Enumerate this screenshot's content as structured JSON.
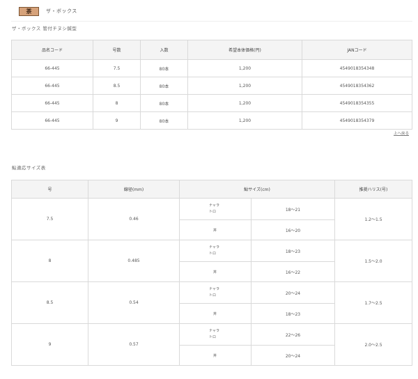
{
  "header": {
    "badge": "茶",
    "title": "ザ・ボックス"
  },
  "section1": {
    "title": "ザ・ボックス 管付チヌシ鍼型",
    "columns": [
      "品名コード",
      "号数",
      "入数",
      "希望本体価格(円)",
      "JANコード"
    ],
    "rows": [
      [
        "66-445",
        "7.5",
        "80本",
        "1,200",
        "4549018354348"
      ],
      [
        "66-445",
        "8.5",
        "80本",
        "1,200",
        "4549018354362"
      ],
      [
        "66-445",
        "8",
        "80本",
        "1,200",
        "4549018354355"
      ],
      [
        "66-445",
        "9",
        "80本",
        "1,200",
        "4549018354379"
      ]
    ],
    "top_link": "上へ戻る"
  },
  "section2": {
    "title": "鮎適応サイズ表",
    "columns": [
      "号",
      "線径(mm)",
      "鮎サイズ(cm)",
      "推奨ハリス(号)"
    ],
    "rows": [
      {
        "gou": "7.5",
        "diameter": "0.46",
        "harisu": "1.2～1.5",
        "types": [
          {
            "label_line1": "ナャラ",
            "label_line2": "トロ",
            "size": "18～21"
          },
          {
            "label": "丼",
            "size": "16～20"
          }
        ]
      },
      {
        "gou": "8",
        "diameter": "0.485",
        "harisu": "1.5～2.0",
        "types": [
          {
            "label_line1": "ナャラ",
            "label_line2": "トロ",
            "size": "18～23"
          },
          {
            "label": "丼",
            "size": "16～22"
          }
        ]
      },
      {
        "gou": "8.5",
        "diameter": "0.54",
        "harisu": "1.7～2.5",
        "types": [
          {
            "label_line1": "ナャラ",
            "label_line2": "トロ",
            "size": "20～24"
          },
          {
            "label": "丼",
            "size": "18～23"
          }
        ]
      },
      {
        "gou": "9",
        "diameter": "0.57",
        "harisu": "2.0～2.5",
        "types": [
          {
            "label_line1": "ナャラ",
            "label_line2": "トロ",
            "size": "22～26"
          },
          {
            "label": "丼",
            "size": "20～24"
          }
        ]
      }
    ]
  }
}
